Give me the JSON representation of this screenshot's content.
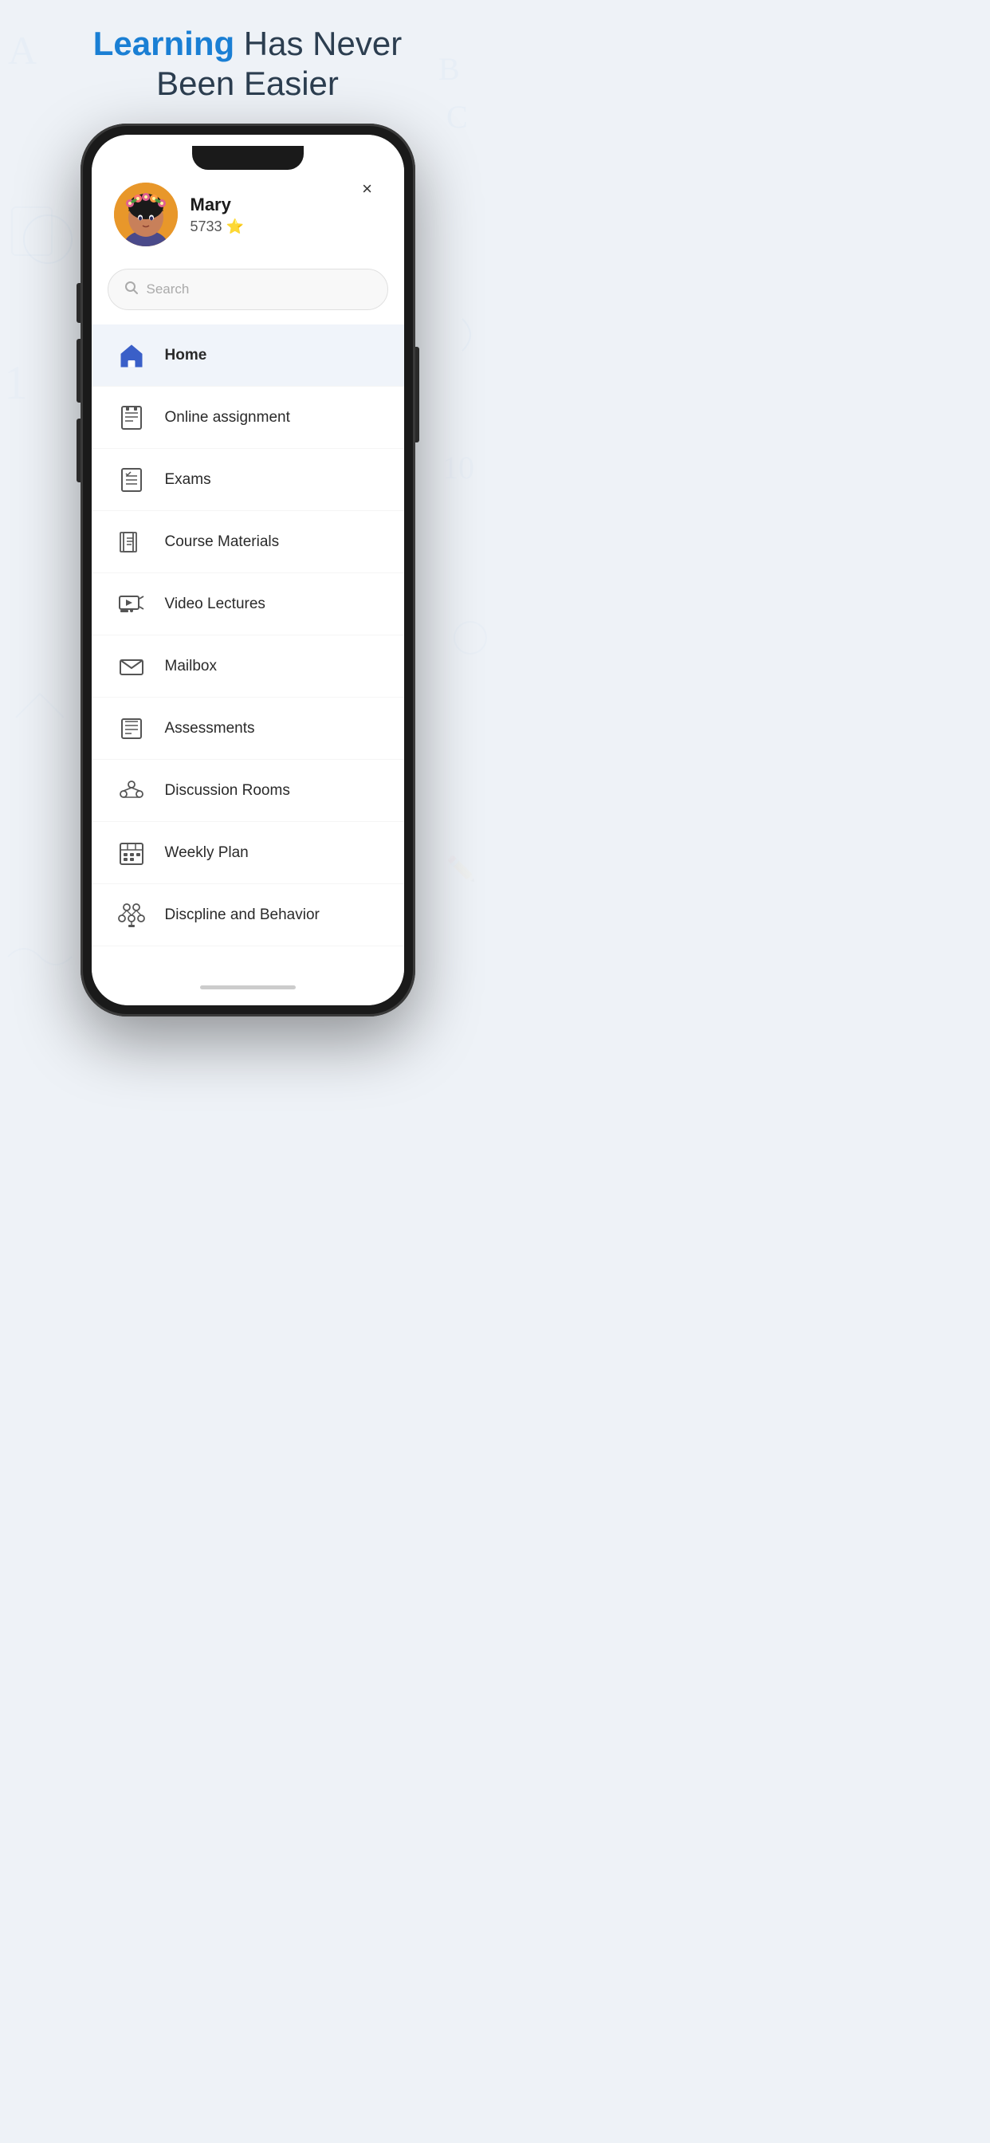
{
  "header": {
    "line1_blue": "Learning",
    "line1_rest": " Has Never",
    "line2": "Been Easier"
  },
  "close_label": "×",
  "user": {
    "name": "Mary",
    "stars": "5733 ⭐"
  },
  "search": {
    "placeholder": "Search"
  },
  "menu": {
    "items": [
      {
        "id": "home",
        "label": "Home",
        "active": true,
        "icon": "home-icon"
      },
      {
        "id": "online-assignment",
        "label": "Online assignment",
        "active": false,
        "icon": "assignment-icon"
      },
      {
        "id": "exams",
        "label": "Exams",
        "active": false,
        "icon": "exams-icon"
      },
      {
        "id": "course-materials",
        "label": "Course Materials",
        "active": false,
        "icon": "course-icon"
      },
      {
        "id": "video-lectures",
        "label": "Video Lectures",
        "active": false,
        "icon": "video-icon"
      },
      {
        "id": "mailbox",
        "label": "Mailbox",
        "active": false,
        "icon": "mailbox-icon"
      },
      {
        "id": "assessments",
        "label": "Assessments",
        "active": false,
        "icon": "assessments-icon"
      },
      {
        "id": "discussion-rooms",
        "label": "Discussion Rooms",
        "active": false,
        "icon": "discussion-icon"
      },
      {
        "id": "weekly-plan",
        "label": "Weekly Plan",
        "active": false,
        "icon": "weekly-icon"
      },
      {
        "id": "discipline",
        "label": "Discpline and Behavior",
        "active": false,
        "icon": "discipline-icon"
      }
    ]
  }
}
